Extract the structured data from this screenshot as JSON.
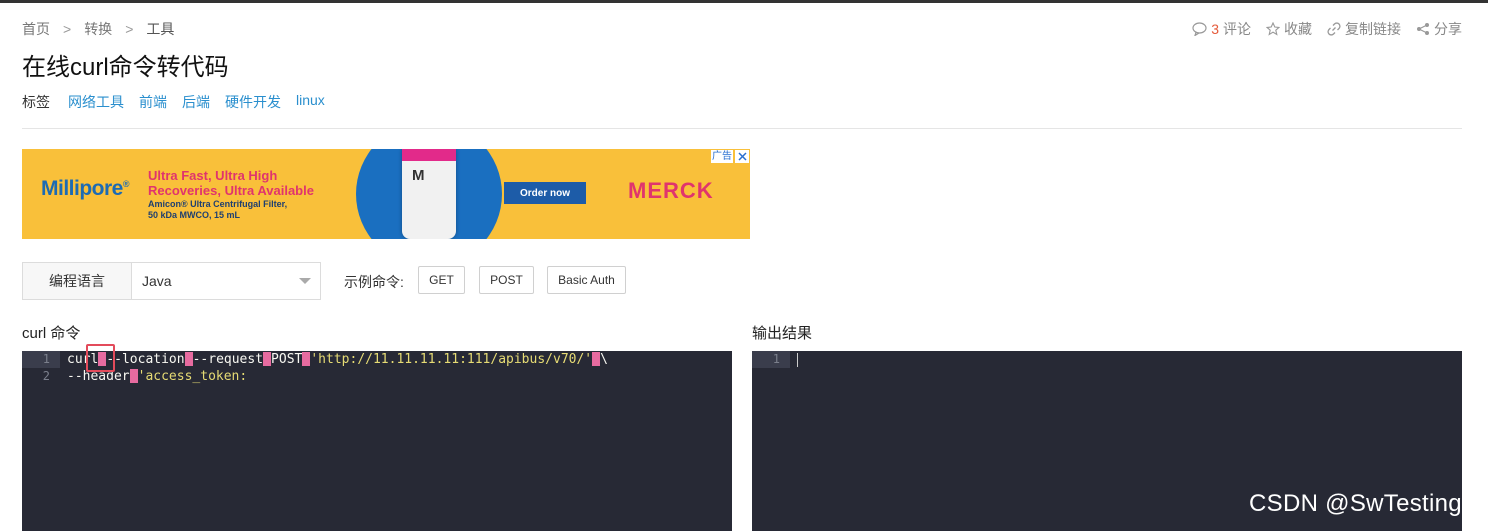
{
  "breadcrumb": [
    "首页",
    "转换",
    "工具"
  ],
  "breadcrumb_separator": ">",
  "actions": {
    "comment_count": "3",
    "comment_label": "评论",
    "favorite_label": "收藏",
    "copy_link_label": "复制链接",
    "share_label": "分享"
  },
  "page_title": "在线curl命令转代码",
  "tags_label": "标签",
  "tags": [
    "网络工具",
    "前端",
    "后端",
    "硬件开发",
    "linux"
  ],
  "ad": {
    "logo": "Millipore",
    "logo_mark": "®",
    "headline_1": "Ultra Fast, Ultra High",
    "headline_2": "Recoveries, Ultra Available",
    "sub_1": "Amicon® Ultra Centrifugal Filter,",
    "sub_2": "50 kDa MWCO, 15 mL",
    "tube_mark": "M",
    "cta": "Order now",
    "brand": "MERCK",
    "ad_tag": "广告"
  },
  "language": {
    "label": "编程语言",
    "selected": "Java"
  },
  "examples": {
    "label": "示例命令:",
    "buttons": [
      "GET",
      "POST",
      "Basic Auth"
    ]
  },
  "input_panel": {
    "title": "curl 命令",
    "line_numbers": [
      "1",
      "2"
    ],
    "line1": {
      "t1": "curl",
      "t2": "--location",
      "t3": "--request",
      "t4": "POST",
      "t5": "'http://11.11.11.11:111/apibus/v70/'",
      "t6": "\\"
    },
    "line2": {
      "t1": "--header",
      "t2": "'access_token:"
    }
  },
  "output_panel": {
    "title": "输出结果",
    "line_numbers": [
      "1"
    ]
  },
  "watermark": "CSDN @SwTesting",
  "colors": {
    "editor_bg": "#272935",
    "whitespace_marker": "#e76ba0",
    "string": "#e6db74",
    "link": "#2a8fce",
    "highlight_box": "#e34b5b"
  }
}
